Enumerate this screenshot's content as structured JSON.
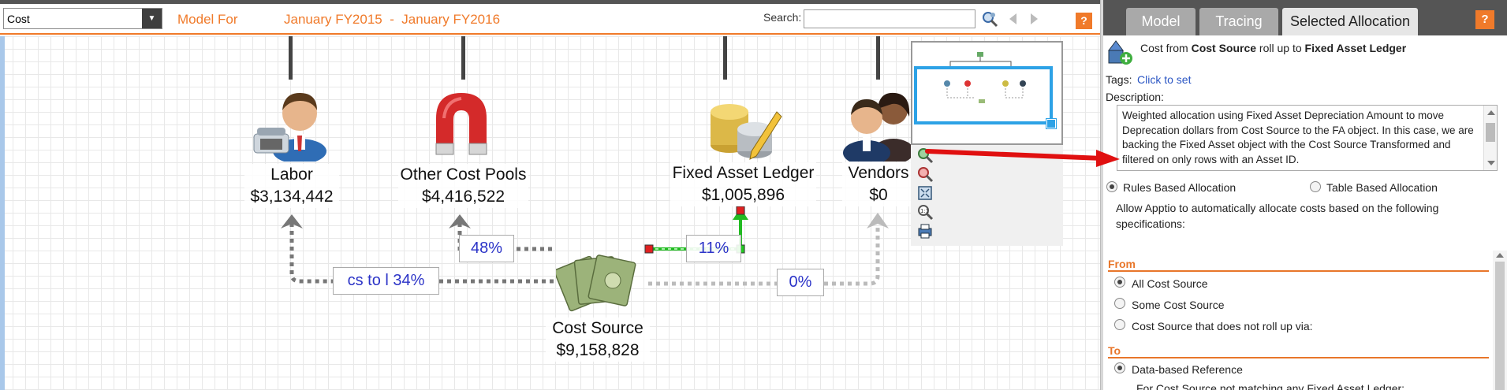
{
  "toolbar": {
    "cost_select_value": "Cost",
    "model_for_label": "Model For",
    "date_range": "January FY2015  -  January FY2016",
    "search_label": "Search:",
    "search_value": "",
    "help_label": "?"
  },
  "nodes": {
    "labor": {
      "name": "Labor",
      "amount": "$3,134,442"
    },
    "other_cost_pools": {
      "name": "Other Cost Pools",
      "amount": "$4,416,522"
    },
    "fixed_asset_ledger": {
      "name": "Fixed Asset Ledger",
      "amount": "$1,005,896"
    },
    "vendors": {
      "name": "Vendors",
      "amount": "$0"
    },
    "cost_source": {
      "name": "Cost Source",
      "amount": "$9,158,828"
    }
  },
  "allocations": {
    "to_labor": "cs to l 34%",
    "to_other_cost_pools": "48%",
    "to_fixed_asset_ledger": "11%",
    "to_vendors": "0%"
  },
  "right_panel": {
    "tabs": [
      "Model",
      "Tracing",
      "Selected Allocation"
    ],
    "active_tab": "Selected Allocation",
    "help_label": "?",
    "title_prefix": "Cost from ",
    "title_source": "Cost Source",
    "title_middle": " roll up to ",
    "title_target": "Fixed Asset Ledger",
    "tags_label": "Tags:",
    "tags_link": "Click to set",
    "description_label": "Description:",
    "description": "Weighted allocation using Fixed Asset Depreciation Amount to move Deprecation dollars from Cost Source to the FA object.  In this case, we are backing the Fixed Asset object with the Cost Source Transformed and filtered on only rows with an Asset ID.",
    "method_rules": "Rules Based Allocation",
    "method_table": "Table Based Allocation",
    "allow_text": "Allow Apptio to automatically allocate costs based on the following specifications:",
    "from_heading": "From",
    "from_options": [
      "All Cost Source",
      "Some Cost Source",
      "Cost Source that does not roll up via:"
    ],
    "to_heading": "To",
    "to_option": "Data-based Reference",
    "to_partial": "For Cost Source not matching any Fixed Asset Ledger:"
  },
  "colors": {
    "accent_orange": "#f07a2a",
    "link_blue": "#2b56c4",
    "selection_green": "#22bb22",
    "navigator_blue": "#2da2e6",
    "annotation_red": "#e01010"
  }
}
